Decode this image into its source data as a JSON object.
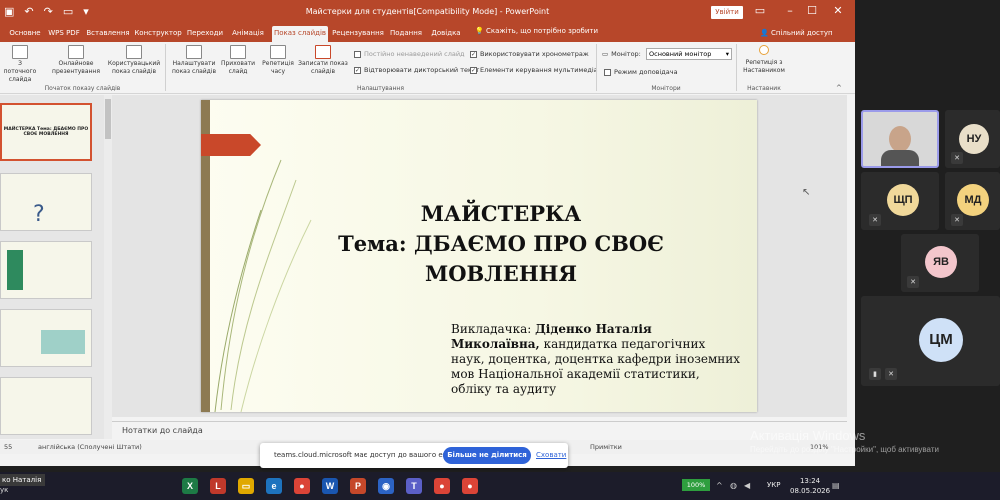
{
  "window": {
    "title": "Майстерки для студентів[Compatibility Mode]  -  PowerPoint",
    "signin_label": "Увійти"
  },
  "tabs": [
    {
      "label": "Основне"
    },
    {
      "label": "WPS PDF"
    },
    {
      "label": "Вставлення"
    },
    {
      "label": "Конструктор"
    },
    {
      "label": "Переходи"
    },
    {
      "label": "Анімація"
    },
    {
      "label": "Показ слайдів",
      "active": true
    },
    {
      "label": "Рецензування"
    },
    {
      "label": "Подання"
    },
    {
      "label": "Довідка"
    }
  ],
  "tell_me": "Скажіть, що потрібно зробити",
  "share_label": "Спільний доступ",
  "ribbon": {
    "buttons": [
      {
        "label": "З поточного слайда"
      },
      {
        "label": "Онлайнове презентування"
      },
      {
        "label": "Користувацький показ слайдів"
      },
      {
        "label": "Налаштувати показ слайдів"
      },
      {
        "label": "Приховати слайд"
      },
      {
        "label": "Репетиція часу"
      },
      {
        "label": "Записати показ слайдів"
      },
      {
        "label": "Репетиція з Наставником"
      }
    ],
    "checkboxes": [
      {
        "label": "Постійно ненаведений слайд",
        "checked": false,
        "disabled": true
      },
      {
        "label": "Відтворювати дикторський текст",
        "checked": true
      },
      {
        "label": "Використовувати хронометраж",
        "checked": true
      },
      {
        "label": "Елементи керування мультимедіа",
        "checked": true
      },
      {
        "label": "Режим доповідача",
        "checked": false
      }
    ],
    "monitor_label": "Монітор:",
    "monitor_value": "Основний монітор",
    "groups": [
      {
        "label": "Початок показу слайдів"
      },
      {
        "label": "Налаштування"
      },
      {
        "label": "Монітори"
      },
      {
        "label": "Наставник"
      }
    ]
  },
  "slide": {
    "title_line1": "МАЙСТЕРКА",
    "title_line2": "Тема: ДБАЄМО ПРО СВОЄ",
    "title_line3": "МОВЛЕННЯ",
    "lecturer_prefix": "Викладачка: ",
    "lecturer_name": "Діденко Наталія Миколаївна,",
    "lecturer_rest": "кандидатка педагогічних наук, доцентка, доцентка кафедри іноземних мов Національної академії статистики, обліку та аудиту"
  },
  "thumb_titles": [
    "МАЙСТЕРКА Тема: ДБАЄМО ПРО СВОЄ МОВЛЕННЯ"
  ],
  "notes_placeholder": "Нотатки до слайда",
  "status": {
    "slide_num": "55",
    "language": "англійська (Сполучені Штати)",
    "comments": "Примітки",
    "zoom": "101%"
  },
  "participants": [
    {
      "initials": "НУ",
      "color": "#e9dfc9"
    },
    {
      "initials": "ЩП",
      "color": "#f0d89a"
    },
    {
      "initials": "МД",
      "color": "#f3d27e"
    },
    {
      "initials": "ЯВ",
      "color": "#f3c6cc"
    },
    {
      "initials": "ЦМ",
      "color": "#cfe1f7"
    }
  ],
  "share_bar": {
    "message": "teams.cloud.microsoft має доступ до вашого екрана.",
    "stop_label": "Більше не ділитися",
    "hide_label": "Сховати"
  },
  "watermark": {
    "line1": "Активація Windows",
    "line2": "Перейдіть до розділу \"Настройки\", щоб активувати"
  },
  "taskbar": {
    "user_name": "ко Наталія",
    "user_sub": "ук",
    "battery": "100%",
    "lang": "УКР",
    "time": "13:24",
    "date": "08.05.2026"
  }
}
